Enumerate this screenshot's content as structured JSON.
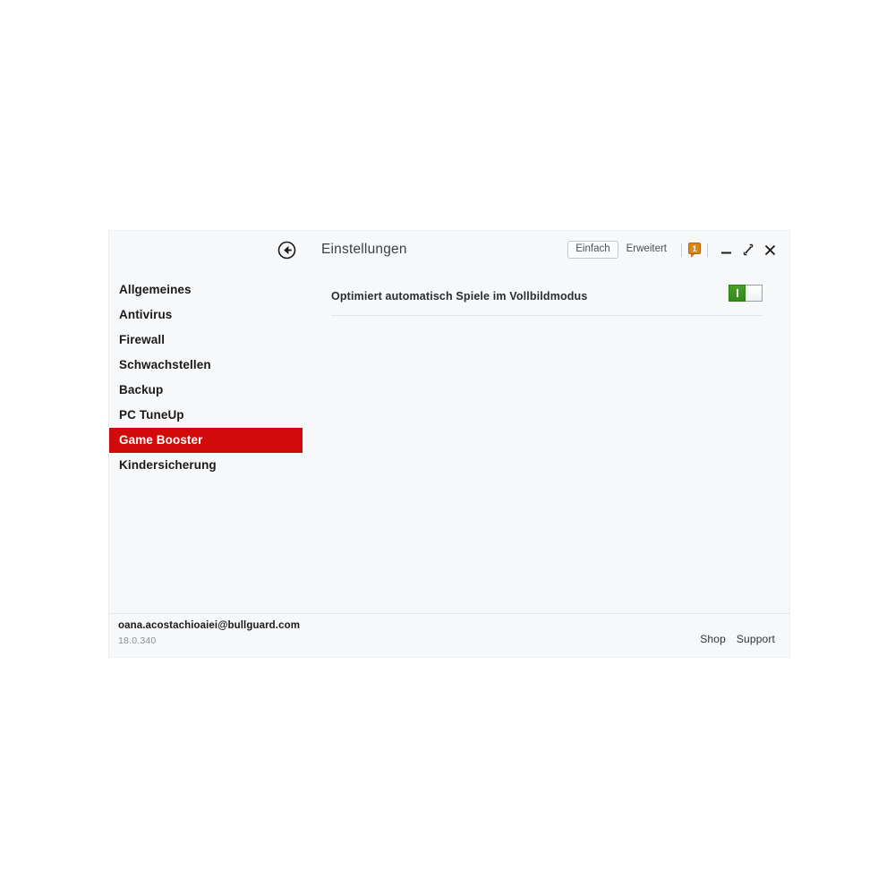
{
  "window": {
    "title": "Einstellungen",
    "back_icon": "back-circle-arrow-icon"
  },
  "titlebar": {
    "modes": [
      {
        "label": "Einfach",
        "active": true
      },
      {
        "label": "Erweitert",
        "active": false
      }
    ],
    "notification_count": "1",
    "controls": [
      {
        "name": "minimize",
        "glyph": "minimize-icon"
      },
      {
        "name": "restore",
        "glyph": "restore-down-icon"
      },
      {
        "name": "close",
        "glyph": "close-icon"
      }
    ]
  },
  "sidebar": {
    "items": [
      {
        "label": "Allgemeines",
        "selected": false
      },
      {
        "label": "Antivirus",
        "selected": false
      },
      {
        "label": "Firewall",
        "selected": false
      },
      {
        "label": "Schwachstellen",
        "selected": false
      },
      {
        "label": "Backup",
        "selected": false
      },
      {
        "label": "PC TuneUp",
        "selected": false
      },
      {
        "label": "Game Booster",
        "selected": true
      },
      {
        "label": "Kindersicherung",
        "selected": false
      }
    ]
  },
  "content": {
    "settings": [
      {
        "label": "Optimiert automatisch Spiele im Vollbildmodus",
        "toggle_state": "on"
      }
    ]
  },
  "footer": {
    "user_email": "oana.acostachioaiei@bullguard.com",
    "version": "18.0.340",
    "links": [
      {
        "label": "Shop"
      },
      {
        "label": "Support"
      }
    ]
  },
  "colors": {
    "selection_red": "#d10a0a",
    "toggle_green": "#46a32a",
    "badge_orange": "#e08214",
    "window_bg": "#f7f8fa",
    "page_bg": "#ffffff"
  }
}
